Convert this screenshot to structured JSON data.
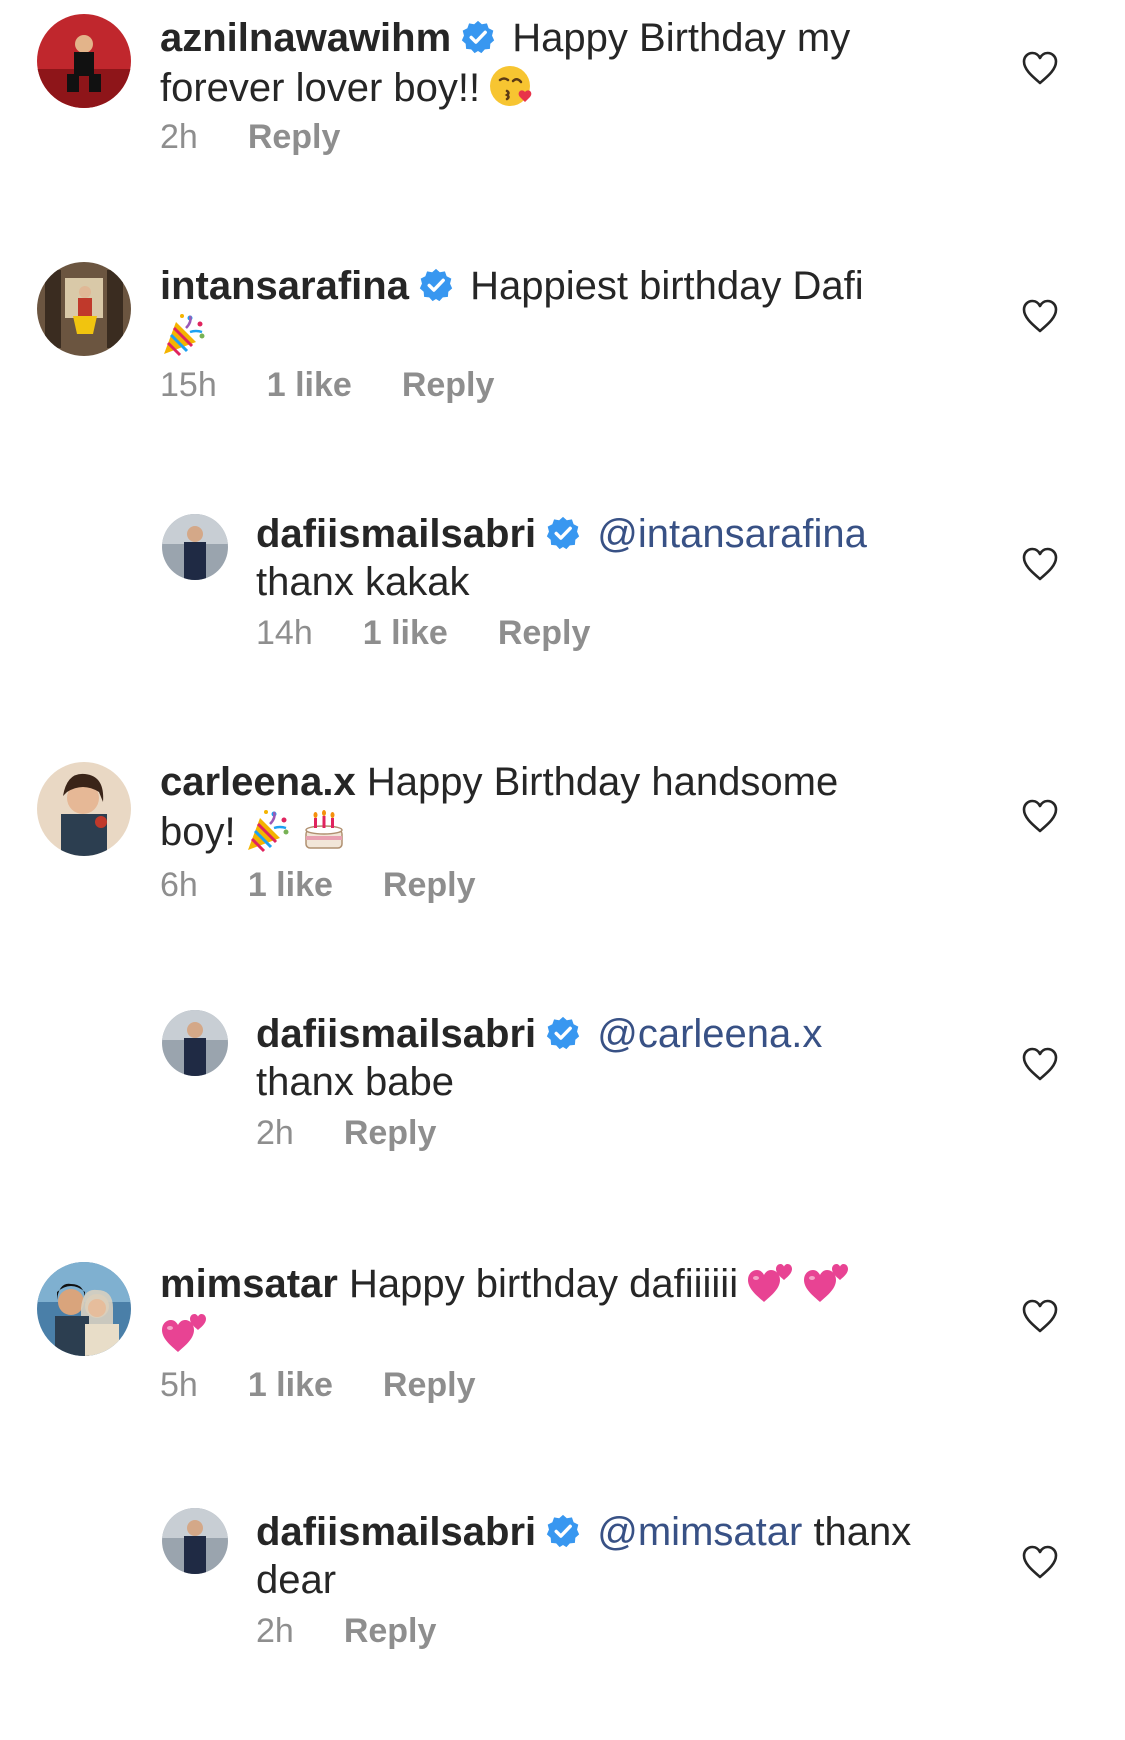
{
  "comments": [
    {
      "username": "aznilnawawihm",
      "verified": true,
      "mention": "",
      "text": "Happy Birthday my forever lover boy!!",
      "emojis": [
        "kissing-face-emoji"
      ],
      "time": "2h",
      "likes": "",
      "reply_label": "Reply",
      "is_reply": false
    },
    {
      "username": "intansarafina",
      "verified": true,
      "mention": "",
      "text": "Happiest birthday Dafi",
      "emojis": [
        "party-popper-emoji"
      ],
      "time": "15h",
      "likes": "1 like",
      "reply_label": "Reply",
      "is_reply": false
    },
    {
      "username": "dafiismailsabri",
      "verified": true,
      "mention": "@intansarafina",
      "text": "thanx kakak",
      "emojis": [],
      "time": "14h",
      "likes": "1 like",
      "reply_label": "Reply",
      "is_reply": true
    },
    {
      "username": "carleena.x",
      "verified": false,
      "mention": "",
      "text": "Happy Birthday handsome boy!",
      "emojis": [
        "party-popper-emoji",
        "birthday-cake-emoji"
      ],
      "time": "6h",
      "likes": "1 like",
      "reply_label": "Reply",
      "is_reply": false
    },
    {
      "username": "dafiismailsabri",
      "verified": true,
      "mention": "@carleena.x",
      "text": "thanx babe",
      "emojis": [],
      "time": "2h",
      "likes": "",
      "reply_label": "Reply",
      "is_reply": true
    },
    {
      "username": "mimsatar",
      "verified": false,
      "mention": "",
      "text": "Happy birthday dafiiiiii",
      "emojis": [
        "two-hearts-emoji",
        "two-hearts-emoji",
        "two-hearts-emoji"
      ],
      "time": "5h",
      "likes": "1 like",
      "reply_label": "Reply",
      "is_reply": false
    },
    {
      "username": "dafiismailsabri",
      "verified": true,
      "mention": "@mimsatar",
      "text": "thanx dear",
      "emojis": [],
      "time": "2h",
      "likes": "",
      "reply_label": "Reply",
      "is_reply": true
    }
  ],
  "colors": {
    "text": "#262626",
    "meta": "#8e8e8e",
    "mention": "#385185",
    "verified_badge": "#3897f0"
  },
  "icons": {
    "verified": "verified-badge-icon",
    "like": "heart-outline-icon"
  }
}
